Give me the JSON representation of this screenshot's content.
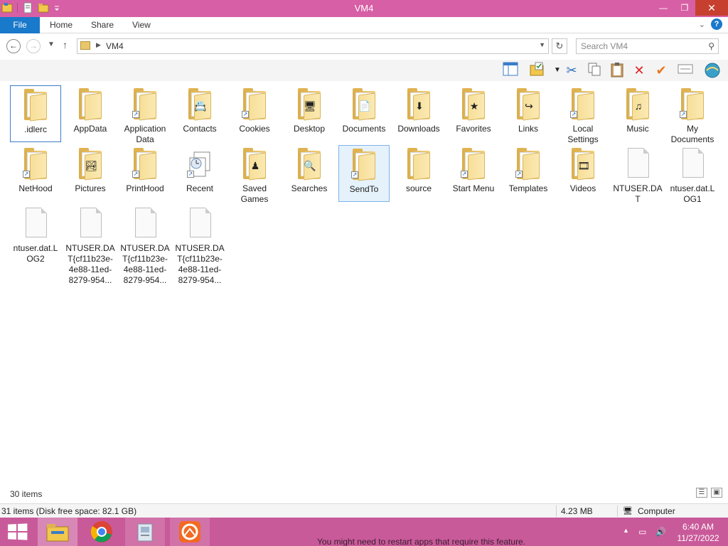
{
  "window": {
    "title": "VM4",
    "controls": {
      "minimize": "—",
      "maximize": "❐",
      "close": "✕"
    }
  },
  "ribbon": {
    "tabs": [
      "File",
      "Home",
      "Share",
      "View"
    ],
    "expand_icon": "⌄",
    "help_icon": "?"
  },
  "address": {
    "breadcrumb": "VM4",
    "search_placeholder": "Search VM4"
  },
  "files": [
    {
      "name": ".idlerc",
      "kind": "folder-doc",
      "state": "focus"
    },
    {
      "name": "AppData",
      "kind": "folder-plain",
      "state": ""
    },
    {
      "name": "Application Data",
      "kind": "folder-shortcut",
      "state": ""
    },
    {
      "name": "Contacts",
      "kind": "folder-contacts",
      "state": ""
    },
    {
      "name": "Cookies",
      "kind": "folder-shortcut",
      "state": ""
    },
    {
      "name": "Desktop",
      "kind": "folder-desktop",
      "state": ""
    },
    {
      "name": "Documents",
      "kind": "folder-documents",
      "state": ""
    },
    {
      "name": "Downloads",
      "kind": "folder-downloads",
      "state": ""
    },
    {
      "name": "Favorites",
      "kind": "folder-favorites",
      "state": ""
    },
    {
      "name": "Links",
      "kind": "folder-links",
      "state": ""
    },
    {
      "name": "Local Settings",
      "kind": "folder-shortcut",
      "state": ""
    },
    {
      "name": "Music",
      "kind": "folder-music",
      "state": ""
    },
    {
      "name": "My Documents",
      "kind": "folder-shortcut-doc",
      "state": ""
    },
    {
      "name": "NetHood",
      "kind": "folder-shortcut",
      "state": ""
    },
    {
      "name": "Pictures",
      "kind": "folder-pictures",
      "state": ""
    },
    {
      "name": "PrintHood",
      "kind": "folder-shortcut",
      "state": ""
    },
    {
      "name": "Recent",
      "kind": "recent",
      "state": ""
    },
    {
      "name": "Saved Games",
      "kind": "folder-games",
      "state": ""
    },
    {
      "name": "Searches",
      "kind": "folder-searches",
      "state": ""
    },
    {
      "name": "SendTo",
      "kind": "folder-shortcut",
      "state": "sel"
    },
    {
      "name": "source",
      "kind": "folder-plain",
      "state": ""
    },
    {
      "name": "Start Menu",
      "kind": "folder-shortcut",
      "state": ""
    },
    {
      "name": "Templates",
      "kind": "folder-shortcut",
      "state": ""
    },
    {
      "name": "Videos",
      "kind": "folder-videos",
      "state": ""
    },
    {
      "name": "NTUSER.DAT",
      "kind": "file",
      "state": ""
    },
    {
      "name": "ntuser.dat.LOG1",
      "kind": "file",
      "state": ""
    },
    {
      "name": "ntuser.dat.LOG2",
      "kind": "file",
      "state": ""
    },
    {
      "name": "NTUSER.DAT{cf11b23e-4e88-11ed-8279-954...",
      "kind": "file",
      "state": ""
    },
    {
      "name": "NTUSER.DAT{cf11b23e-4e88-11ed-8279-954...",
      "kind": "file",
      "state": ""
    },
    {
      "name": "NTUSER.DAT{cf11b23e-4e88-11ed-8279-954...",
      "kind": "file",
      "state": ""
    }
  ],
  "status": {
    "item_count": "30 items",
    "disk_info": "31 items (Disk free space: 82.1 GB)",
    "size": "4.23 MB",
    "location": "Computer"
  },
  "taskbar": {
    "notice": "You might need to restart apps that require this feature.",
    "time": "6:40 AM",
    "date": "11/27/2022"
  }
}
